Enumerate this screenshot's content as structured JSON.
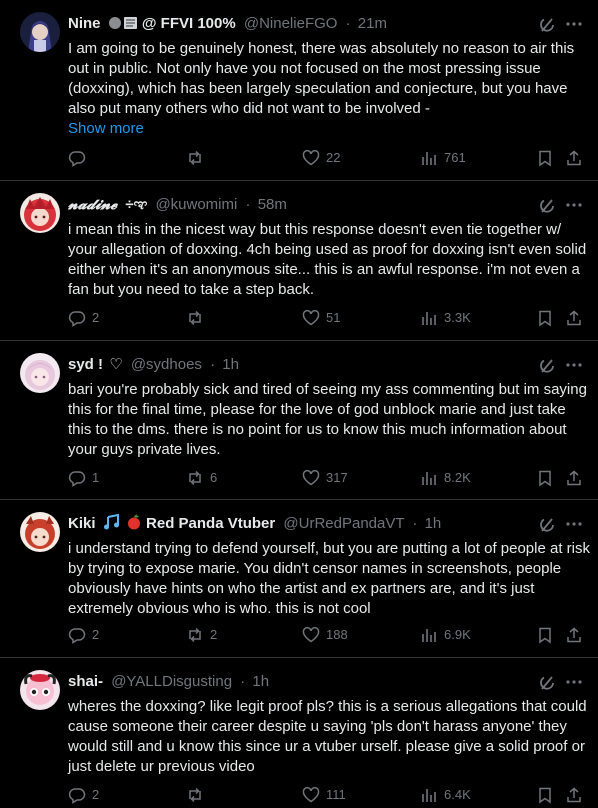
{
  "tweets": [
    {
      "display_name": "Nine",
      "name_suffix": "@ FFVI 100%",
      "handle": "@NinelieFGO",
      "time": "21m",
      "text": "I am going to be genuinely honest, there was absolutely no reason to air this out in public. Not only have you not focused on the most pressing issue (doxxing), which has been largely speculation and conjecture, but you have also put many others who did not want to be involved -",
      "show_more": "Show more",
      "replies": "",
      "reposts": "",
      "likes": "22",
      "views": "761"
    },
    {
      "display_name": "𝓷𝓪𝓭𝓲𝓷𝓮",
      "name_suffix": "÷ಞ",
      "handle": "@kuwomimi",
      "time": "58m",
      "text": "i mean this in the nicest way but this response doesn't even tie together w/ your allegation of doxxing. 4ch being used as proof for doxxing isn't even solid either when it's an anonymous site... this is an awful response. i'm not even a fan but you need to take a step back.",
      "replies": "2",
      "reposts": "",
      "likes": "51",
      "views": "3.3K"
    },
    {
      "display_name": "syd !",
      "name_suffix": "♡",
      "handle": "@sydhoes",
      "time": "1h",
      "text": "bari you're probably sick and tired of seeing my ass commenting but im saying this for the final time, please for the love of god unblock marie and just take this to the dms. there is no point for us to know this much information about your guys private lives.",
      "replies": "1",
      "reposts": "6",
      "likes": "317",
      "views": "8.2K"
    },
    {
      "display_name": "Kiki",
      "name_suffix": "Red Panda Vtuber",
      "handle": "@UrRedPandaVT",
      "time": "1h",
      "text": "i understand trying to defend yourself, but you are putting a lot of people at risk by trying to expose marie. You didn't censor names in screenshots, people obviously have hints on who the artist and ex partners are, and it's just extremely obvious who is who. this is not cool",
      "replies": "2",
      "reposts": "2",
      "likes": "188",
      "views": "6.9K"
    },
    {
      "display_name": "shai-",
      "name_suffix": "",
      "handle": "@YALLDisgusting",
      "time": "1h",
      "text": "wheres the doxxing? like legit proof pls? this is a serious allegations that could cause someone their career despite u saying 'pls don't harass anyone' they would still and u know this since ur a vtuber urself. please give a solid proof or just delete ur previous video",
      "replies": "2",
      "reposts": "",
      "likes": "111",
      "views": "6.4K"
    }
  ],
  "separator": "·",
  "colors": {
    "background": "#000000",
    "text": "#e7e9ea",
    "muted": "#71767b",
    "link": "#1d9bf0",
    "border": "#2f3336"
  }
}
